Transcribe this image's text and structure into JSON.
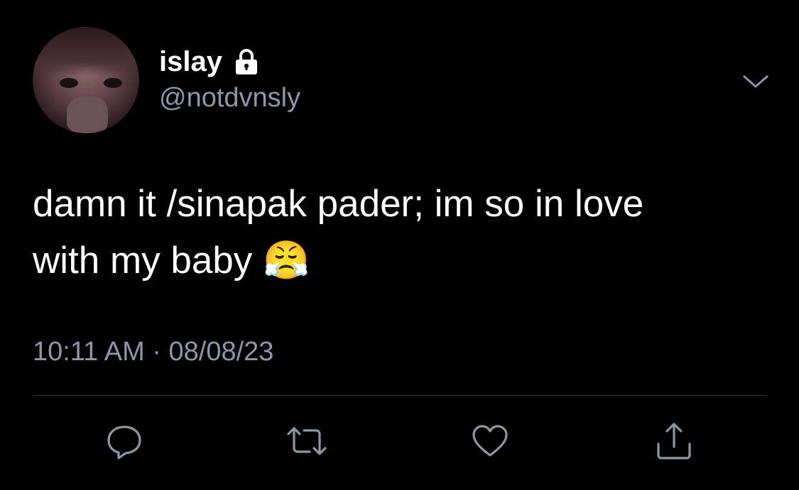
{
  "author": {
    "display_name": "islay",
    "handle": "@notdvnsly",
    "protected_icon": "lock-icon",
    "avatar": "profile-photo"
  },
  "tweet": {
    "text": "damn it /sinapak pader; im so in love\nwith my baby 😤",
    "time": "10:11 AM",
    "separator": "·",
    "date": "08/08/23"
  },
  "actions": {
    "reply_icon": "reply-icon",
    "retweet_icon": "retweet-icon",
    "like_icon": "heart-icon",
    "share_icon": "share-icon"
  },
  "menu": {
    "icon": "chevron-down-icon"
  },
  "colors": {
    "background": "#000000",
    "text": "#ffffff",
    "secondary_text": "#8b98a5",
    "divider": "#2f3336"
  }
}
